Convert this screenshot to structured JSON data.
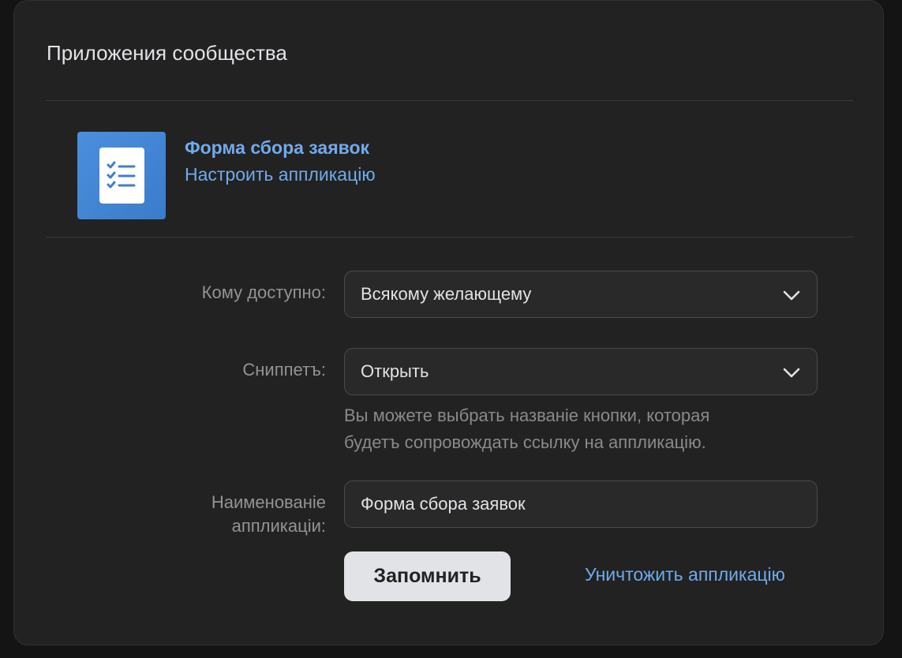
{
  "page": {
    "title": "Приложения сообщества"
  },
  "app": {
    "icon": "checklist-icon",
    "name": "Форма сбора заявок",
    "configure_link": "Настроить аппликацію",
    "tile_color": "#4a8fdd"
  },
  "form": {
    "access": {
      "label": "Кому доступно:",
      "value": "Всякому желающему"
    },
    "snippet": {
      "label": "Сниппетъ:",
      "value": "Открыть",
      "hint_line1": "Вы можете выбрать названіе кнопки, которая",
      "hint_line2": "будетъ сопровождать ссылку на аппликацію."
    },
    "app_name": {
      "label_line1": "Наименованіе",
      "label_line2": "аппликаціи:",
      "value": "Форма сбора заявок"
    },
    "save_label": "Запомнить",
    "delete_label": "Уничтожить аппликацію"
  },
  "colors": {
    "background": "#141414",
    "card": "#222222",
    "link": "#71aaeb",
    "button": "#e1e3e6"
  }
}
